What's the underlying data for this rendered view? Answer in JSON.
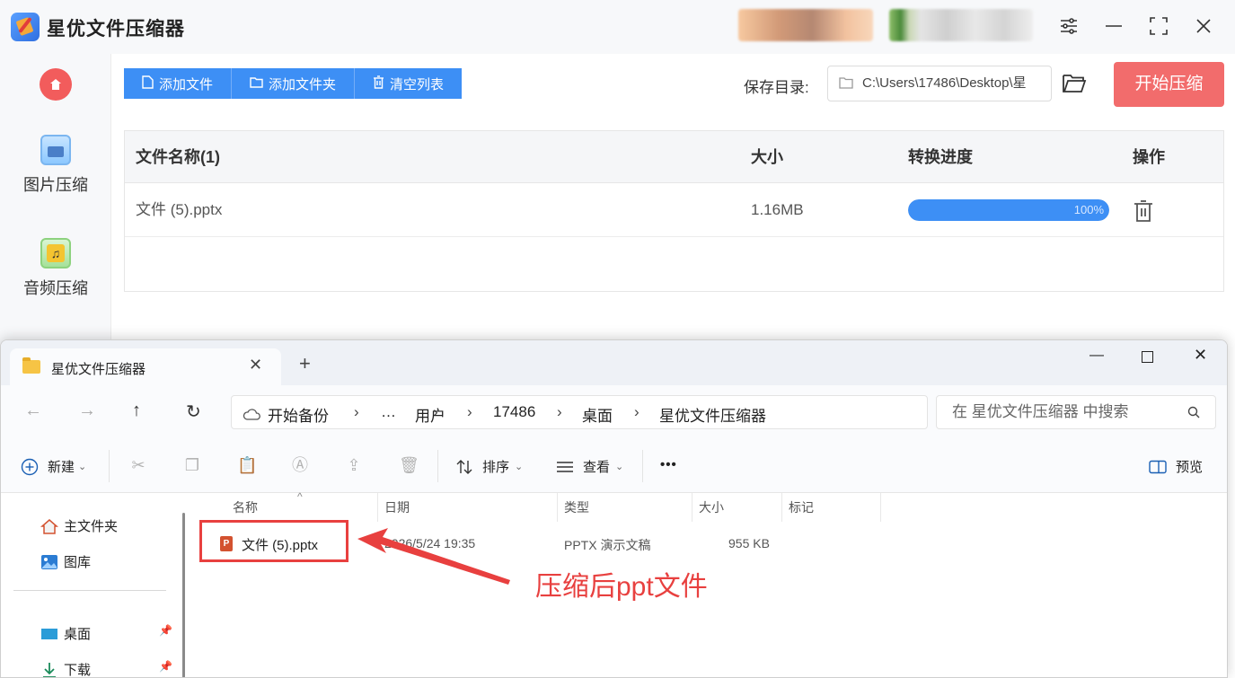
{
  "app": {
    "title": "星优文件压缩器",
    "sidebar": {
      "items": [
        {
          "label": "图片压缩"
        },
        {
          "label": "音频压缩"
        }
      ]
    },
    "toolbar": {
      "add_file": "添加文件",
      "add_folder": "添加文件夹",
      "clear_list": "清空列表"
    },
    "save": {
      "label": "保存目录:",
      "path": "C:\\Users\\17486\\Desktop\\星"
    },
    "start_button": "开始压缩",
    "table": {
      "headers": {
        "name": "文件名称(1)",
        "size": "大小",
        "progress": "转换进度",
        "action": "操作"
      },
      "rows": [
        {
          "name": "文件 (5).pptx",
          "size": "1.16MB",
          "progress": 1.0,
          "progress_text": "100%"
        }
      ]
    }
  },
  "explorer": {
    "tab_title": "星优文件压缩器",
    "breadcrumb": [
      "开始备份",
      "…",
      "用户",
      "17486",
      "桌面",
      "星优文件压缩器"
    ],
    "search_placeholder": "在 星优文件压缩器 中搜索",
    "commands": {
      "new": "新建",
      "sort": "排序",
      "view": "查看",
      "more": "•••",
      "preview": "预览"
    },
    "nav": {
      "home": "主文件夹",
      "gallery": "图库",
      "desktop": "桌面",
      "downloads": "下载"
    },
    "columns": [
      "名称",
      "日期",
      "类型",
      "大小",
      "标记"
    ],
    "file": {
      "name": "文件 (5).pptx",
      "date": "2026/5/24 19:35",
      "type": "PPTX 演示文稿",
      "size": "955 KB"
    }
  },
  "annotation": {
    "text": "压缩后ppt文件",
    "color": "#e8403f"
  },
  "colors": {
    "accent_blue": "#3d8ff5",
    "start_red": "#f26c6c"
  }
}
